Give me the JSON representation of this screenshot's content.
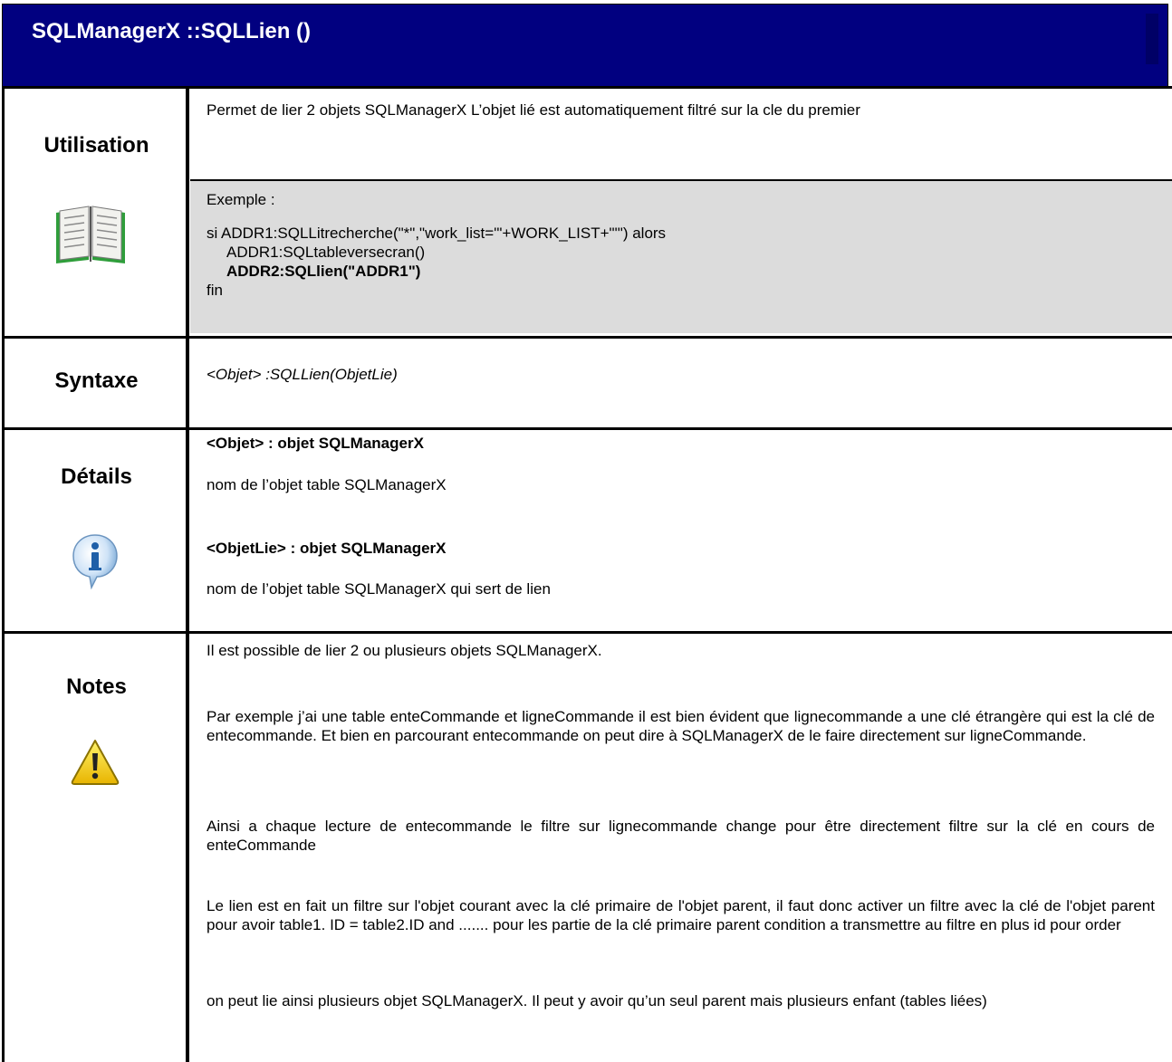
{
  "header": {
    "title": "SQLManagerX ::SQLLien ()"
  },
  "sections": {
    "utilisation": {
      "label": "Utilisation",
      "description": "Permet de lier 2 objets SQLManagerX L’objet lié est automatiquement filtré sur la cle du premier",
      "example": {
        "heading": "Exemple :",
        "line1": "si ADDR1:SQLLitrecherche(\"*\",\"work_list='\"+WORK_LIST+\"'\") alors",
        "line2": "ADDR1:SQLtableversecran()",
        "line3": "ADDR2:SQLlien(\"ADDR1\")",
        "line4": "fin"
      },
      "icon": "book-icon"
    },
    "syntaxe": {
      "label": "Syntaxe",
      "value": "<Objet> :SQLLien(ObjetLie)"
    },
    "details": {
      "label": "Détails",
      "icon": "info-icon",
      "param1_title": "<Objet> : objet SQLManagerX",
      "param1_desc": "nom de l’objet table SQLManagerX",
      "param2_title": "<ObjetLie> : objet SQLManagerX",
      "param2_desc": "nom de l’objet table SQLManagerX qui sert de lien"
    },
    "notes": {
      "label": "Notes",
      "icon": "warning-icon",
      "p1": "Il est possible de lier 2 ou plusieurs objets SQLManagerX.",
      "p2": "Par exemple j’ai une table enteCommande et ligneCommande il est bien évident que lignecommande a une clé étrangère qui est la clé de entecommande. Et bien en  parcourant entecommande on peut dire à SQLManagerX de le faire directement sur ligneCommande.",
      "p3": "Ainsi a chaque lecture de entecommande le filtre sur lignecommande change pour être directement filtre sur la clé en cours de enteCommande",
      "p4": "Le lien est en fait un filtre sur l'objet courant avec la clé primaire de l'objet parent, il faut donc activer un filtre avec la clé de l'objet parent pour avoir table1. ID = table2.ID and ....... pour les partie de la clé primaire parent condition a transmettre au filtre en plus id pour order",
      "p5": "on peut lie ainsi plusieurs objet SQLManagerX. Il peut y avoir qu’un seul parent mais plusieurs enfant (tables liées)"
    }
  }
}
